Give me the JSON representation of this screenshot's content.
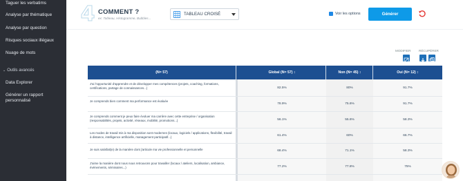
{
  "sidebar": {
    "items": [
      {
        "label": "Taguer les verbatims"
      },
      {
        "label": "Analyse par thématique"
      },
      {
        "label": "Analyse par question"
      },
      {
        "label": "Risques sociaux illégaux"
      },
      {
        "label": "Nuage de mots"
      }
    ],
    "tools_section": "Outils avancés",
    "tools_items": [
      {
        "label": "Data Explorer"
      },
      {
        "label": "Générer un rapport"
      },
      {
        "label": "personnalisé"
      }
    ]
  },
  "header": {
    "step_number": "4",
    "title": "COMMENT ?",
    "subtitle": "ex: Tableau, Histogramme, Bubbles...",
    "select_value": "TABLEAU CROISÉ",
    "options_label": "Voir les options",
    "generate_label": "Générer"
  },
  "toolbar": {
    "modifier": "MODIFIER",
    "recuperer": "RÉCUPÉRER"
  },
  "table": {
    "headers": [
      "(N= 57)",
      "Global (N= 57) ↕",
      "Non (N= 45) ↕",
      "Oui (N= 12) ↕"
    ],
    "rows": [
      {
        "q": "J'ai l'opportunité d'apprendre et de développer mes compétences (projets, coaching, formations, certifications, partage de connaissances...)",
        "g": "82.5%",
        "n": "80%",
        "o": "91.7%"
      },
      {
        "q": "Je comprends bien comment ma performance est évaluée",
        "g": "78.9%",
        "n": "75.6%",
        "o": "91.7%"
      },
      {
        "q": "Je comprends comment je peux faire évoluer ma carrière avec cette entreprise / organisation (responsabilités, projets, activité, réseaux, mobilité, promotions...)",
        "g": "56.1%",
        "n": "55.6%",
        "o": "58.3%"
      },
      {
        "q": "Les modes de travail mis à ma disposition sont modernes (locaux, logiciels / applications, flexibilité, travail à distance, intelligence artificielle, management participatif...)",
        "g": "61.4%",
        "n": "60%",
        "o": "66.7%"
      },
      {
        "q": "Je suis satisfait(e) de la manière dont j'articule ma vie professionnelle et personnelle",
        "g": "68.4%",
        "n": "71.1%",
        "o": "58.3%"
      },
      {
        "q": "J'aime la manière dont nous nous retrouvons pour travailler (locaux / ateliers, localisation, ambiance, événements, séminaires...)",
        "g": "77.2%",
        "n": "77.8%",
        "o": "75%"
      },
      {
        "q": "",
        "g": "",
        "n": "",
        "o": ""
      }
    ]
  },
  "colors": {
    "sidebar_bg": "#2b2e35",
    "table_header": "#1d4f91",
    "accent_button": "#0e9ae8",
    "reset_red": "#e53935"
  }
}
